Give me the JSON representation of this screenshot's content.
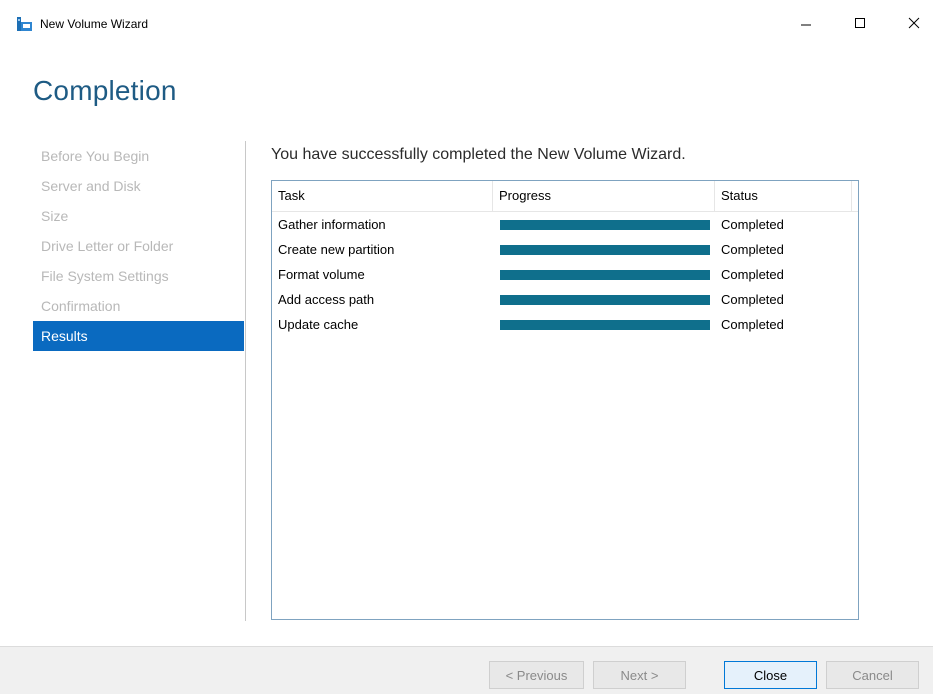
{
  "window": {
    "title": "New Volume Wizard",
    "icon": "volume-wizard-icon",
    "controls": [
      "minimize-icon",
      "maximize-icon",
      "close-icon"
    ]
  },
  "page": {
    "title": "Completion"
  },
  "nav": {
    "items": [
      {
        "label": "Before You Begin",
        "active": false
      },
      {
        "label": "Server and Disk",
        "active": false
      },
      {
        "label": "Size",
        "active": false
      },
      {
        "label": "Drive Letter or Folder",
        "active": false
      },
      {
        "label": "File System Settings",
        "active": false
      },
      {
        "label": "Confirmation",
        "active": false
      },
      {
        "label": "Results",
        "active": true
      }
    ]
  },
  "main": {
    "heading": "You have successfully completed the New Volume Wizard.",
    "table": {
      "columns": [
        "Task",
        "Progress",
        "Status"
      ],
      "rows": [
        {
          "task": "Gather information",
          "progress": 1.0,
          "status": "Completed"
        },
        {
          "task": "Create new partition",
          "progress": 1.0,
          "status": "Completed"
        },
        {
          "task": "Format volume",
          "progress": 1.0,
          "status": "Completed"
        },
        {
          "task": "Add access path",
          "progress": 1.0,
          "status": "Completed"
        },
        {
          "task": "Update cache",
          "progress": 1.0,
          "status": "Completed"
        }
      ]
    }
  },
  "footer": {
    "previous_label": "< Previous",
    "next_label": "Next >",
    "close_label": "Close",
    "cancel_label": "Cancel"
  },
  "colors": {
    "accent": "#0a6ac0",
    "progress": "#0f6f8c",
    "title": "#1e5b84"
  }
}
